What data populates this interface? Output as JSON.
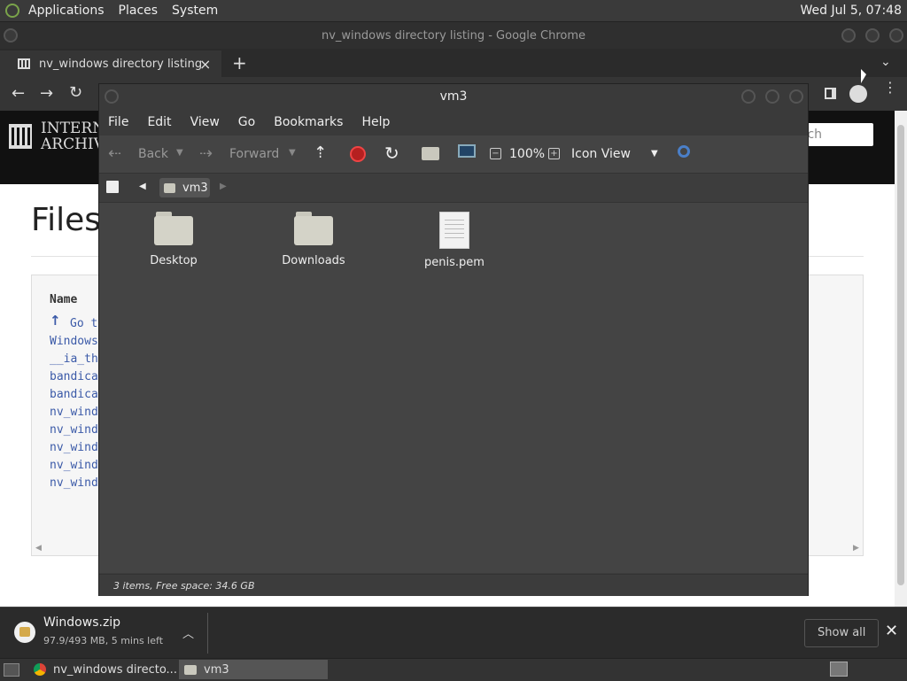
{
  "system_panel": {
    "menus": [
      "Applications",
      "Places",
      "System"
    ],
    "clock": "Wed Jul 5, 07:48"
  },
  "chrome": {
    "window_title": "nv_windows directory listing - Google Chrome",
    "tab_title": "nv_windows directory listing",
    "tab_close": "×",
    "new_tab": "+"
  },
  "page": {
    "logo_line1": "INTERN",
    "logo_line2": "ARCHIV",
    "search_placeholder": "rch",
    "files_heading": "Files",
    "name_column": "Name",
    "rows": [
      "Go t",
      "Windows",
      "__ia_th",
      "bandica",
      "bandica",
      "nv_wind",
      "nv_wind",
      "nv_wind",
      "nv_wind",
      "nv_wind"
    ]
  },
  "file_manager": {
    "title": "vm3",
    "menus": [
      "File",
      "Edit",
      "View",
      "Go",
      "Bookmarks",
      "Help"
    ],
    "toolbar": {
      "back": "Back",
      "forward": "Forward",
      "zoom": "100%",
      "view_mode": "Icon View"
    },
    "location": "vm3",
    "items": [
      {
        "name": "Desktop",
        "kind": "folder"
      },
      {
        "name": "Downloads",
        "kind": "folder"
      },
      {
        "name": "penis.pem",
        "kind": "file"
      }
    ],
    "status": "3 items, Free space: 34.6 GB"
  },
  "download": {
    "filename": "Windows.zip",
    "progress": "97.9/493 MB, 5 mins left",
    "show_all": "Show all"
  },
  "taskbar": {
    "chrome_task": "nv_windows directo...",
    "fm_task": "vm3"
  }
}
